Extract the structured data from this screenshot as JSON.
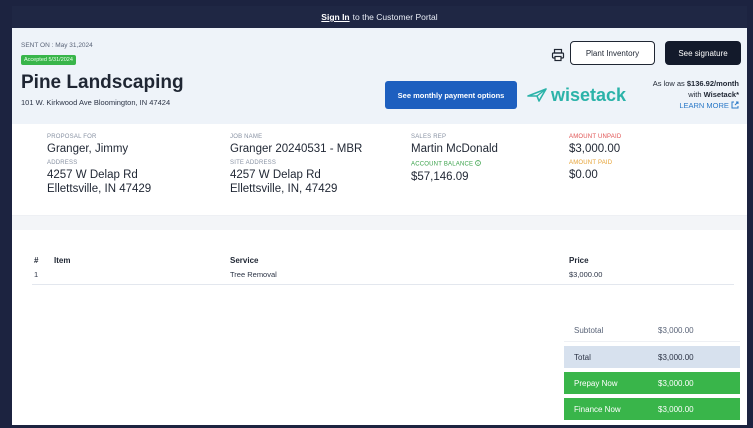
{
  "topbar": {
    "link": "Sign In",
    "text": "to the Customer Portal"
  },
  "header": {
    "sent_on": "SENT ON : May 31,2024",
    "accepted": "Accepted 5/31/2024",
    "company": "Pine Landscaping",
    "address": "101 W. Kirkwood Ave  Bloomington, IN 47424",
    "print_icon": "printer-icon",
    "plant_inventory": "Plant Inventory",
    "see_signature": "See signature",
    "monthly_button": "See monthly payment options",
    "wisetack": "wisetack",
    "as_low_prefix": "As low as ",
    "as_low_amount": "$136.92/month",
    "with": "with ",
    "wisetack_brand": "Wisetack*",
    "learn_more": "LEARN MORE",
    "learn_more_icon": "external-link-icon"
  },
  "info": {
    "proposal_for_label": "PROPOSAL FOR",
    "proposal_for": "Granger, Jimmy",
    "address_label": "ADDRESS",
    "address_line1": "4257 W Delap Rd",
    "address_line2": "Ellettsville, IN 47429",
    "job_name_label": "JOB NAME",
    "job_name": "Granger 20240531 - MBR",
    "site_address_label": "SITE ADDRESS",
    "site_line1": "4257 W Delap Rd",
    "site_line2": "Ellettsville, IN, 47429",
    "sales_rep_label": "SALES REP",
    "sales_rep": "Martin McDonald",
    "account_balance_label": "ACCOUNT BALANCE",
    "account_balance": "$57,146.09",
    "amount_unpaid_label": "AMOUNT UNPAID",
    "amount_unpaid": "$3,000.00",
    "amount_paid_label": "AMOUNT PAID",
    "amount_paid": "$0.00"
  },
  "table": {
    "headers": {
      "num": "#",
      "item": "Item",
      "service": "Service",
      "price": "Price"
    },
    "rows": [
      {
        "num": "1",
        "item": "",
        "service": "Tree Removal",
        "price": "$3,000.00"
      }
    ]
  },
  "totals": {
    "subtotal_label": "Subtotal",
    "subtotal": "$3,000.00",
    "total_label": "Total",
    "total": "$3,000.00",
    "prepay_label": "Prepay Now",
    "prepay": "$3,000.00",
    "finance_label": "Finance Now",
    "finance": "$3,000.00"
  },
  "colors": {
    "accent_blue": "#1d5fbf",
    "green": "#39b54a",
    "dark": "#131a2b",
    "wisetack": "#2bb3a9"
  }
}
